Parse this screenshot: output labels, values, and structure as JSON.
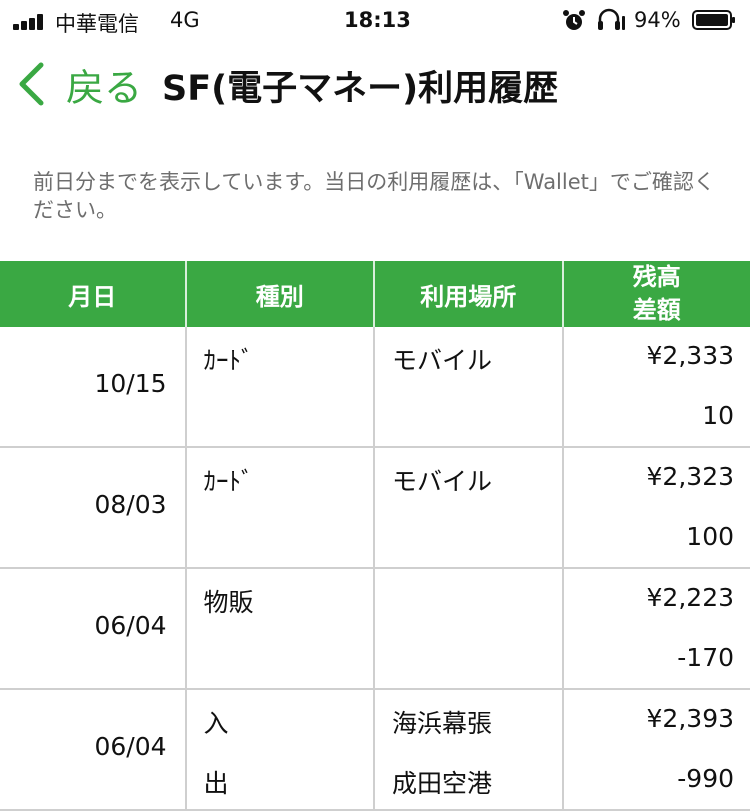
{
  "status_bar": {
    "carrier": "中華電信",
    "network": "4G",
    "time": "18:13",
    "battery_percent": "94%"
  },
  "nav": {
    "back_label": "戻る",
    "title": "SF(電子マネー)利用履歴"
  },
  "notice": "前日分までを表示しています。当日の利用履歴は、「Wallet」でご確認ください。",
  "table": {
    "headers": {
      "date": "月日",
      "type": "種別",
      "place": "利用場所",
      "balance_line1": "残高",
      "balance_line2": "差額"
    },
    "rows": [
      {
        "date": "10/15",
        "type1": "ｶｰﾄﾞ",
        "type2": "",
        "place1": "モバイル",
        "place2": "",
        "balance": "¥2,333",
        "diff": "10"
      },
      {
        "date": "08/03",
        "type1": "ｶｰﾄﾞ",
        "type2": "",
        "place1": "モバイル",
        "place2": "",
        "balance": "¥2,323",
        "diff": "100"
      },
      {
        "date": "06/04",
        "type1": "物販",
        "type2": "",
        "place1": "",
        "place2": "",
        "balance": "¥2,223",
        "diff": "-170"
      },
      {
        "date": "06/04",
        "type1": "入",
        "type2": "出",
        "place1": "海浜幕張",
        "place2": "成田空港",
        "balance": "¥2,393",
        "diff": "-990"
      }
    ]
  },
  "colors": {
    "accent": "#3aa843",
    "header_text": "#ffffff",
    "notice_text": "#6e6e6e",
    "grid": "#cfcfcf"
  }
}
